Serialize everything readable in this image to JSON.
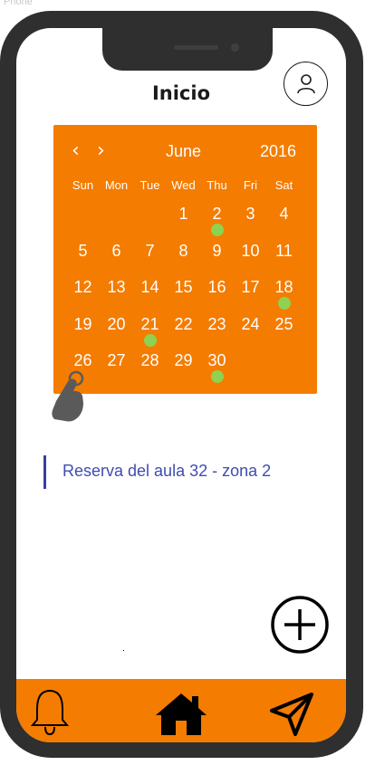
{
  "frame": {
    "label": "Phone"
  },
  "header": {
    "title": "Inicio"
  },
  "calendar": {
    "month": "June",
    "year": "2016",
    "prev_glyph": "‹",
    "next_glyph": "›",
    "weekdays": [
      "Sun",
      "Mon",
      "Tue",
      "Wed",
      "Thu",
      "Fri",
      "Sat"
    ],
    "days": [
      "",
      "",
      "",
      "1",
      "2",
      "3",
      "4",
      "5",
      "6",
      "7",
      "8",
      "9",
      "10",
      "11",
      "12",
      "13",
      "14",
      "15",
      "16",
      "17",
      "18",
      "19",
      "20",
      "21",
      "22",
      "23",
      "24",
      "25",
      "26",
      "27",
      "28",
      "29",
      "30"
    ],
    "event_days": [
      "2",
      "18",
      "21",
      "30"
    ],
    "event_dot_color": "#8fd150",
    "accent_color": "#f47c00"
  },
  "events": [
    {
      "title": "Reserva del aula 32 - zona 2"
    }
  ],
  "bottom_nav": {
    "items": [
      {
        "icon": "bell-icon"
      },
      {
        "icon": "home-icon"
      },
      {
        "icon": "send-icon"
      }
    ]
  },
  "icons": {
    "profile": "user-icon",
    "add": "plus-circle-icon",
    "pointer": "hand-pointer-icon"
  }
}
